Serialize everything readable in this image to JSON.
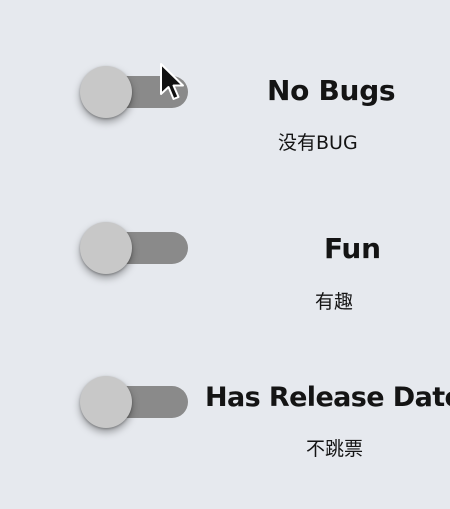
{
  "settings": [
    {
      "title": "No Bugs",
      "subtitle": "没有BUG",
      "enabled": false
    },
    {
      "title": "Fun",
      "subtitle": "有趣",
      "enabled": false
    },
    {
      "title": "Has Release Date",
      "subtitle": "不跳票",
      "enabled": false
    }
  ],
  "icons": {
    "cursor": "mouse-pointer-icon"
  },
  "colors": {
    "background": "#e6e9ee",
    "track": "#8a8a8a",
    "knob": "#c8c8c8",
    "text": "#141414"
  }
}
